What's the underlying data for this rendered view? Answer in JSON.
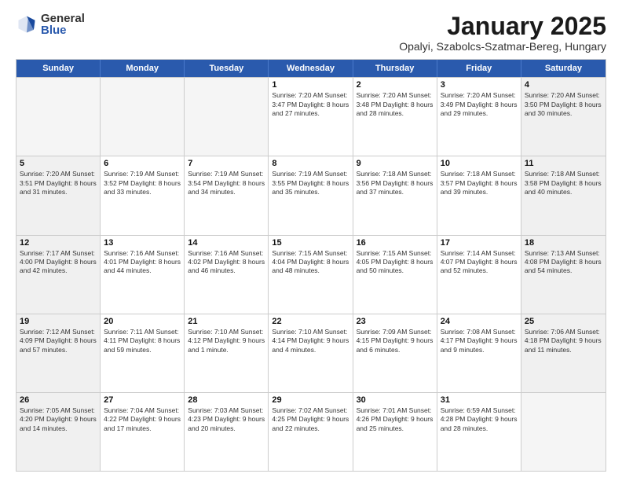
{
  "logo": {
    "general": "General",
    "blue": "Blue"
  },
  "title": "January 2025",
  "subtitle": "Opalyi, Szabolcs-Szatmar-Bereg, Hungary",
  "days_of_week": [
    "Sunday",
    "Monday",
    "Tuesday",
    "Wednesday",
    "Thursday",
    "Friday",
    "Saturday"
  ],
  "weeks": [
    [
      {
        "day": "",
        "info": ""
      },
      {
        "day": "",
        "info": ""
      },
      {
        "day": "",
        "info": ""
      },
      {
        "day": "1",
        "info": "Sunrise: 7:20 AM\nSunset: 3:47 PM\nDaylight: 8 hours and 27 minutes."
      },
      {
        "day": "2",
        "info": "Sunrise: 7:20 AM\nSunset: 3:48 PM\nDaylight: 8 hours and 28 minutes."
      },
      {
        "day": "3",
        "info": "Sunrise: 7:20 AM\nSunset: 3:49 PM\nDaylight: 8 hours and 29 minutes."
      },
      {
        "day": "4",
        "info": "Sunrise: 7:20 AM\nSunset: 3:50 PM\nDaylight: 8 hours and 30 minutes."
      }
    ],
    [
      {
        "day": "5",
        "info": "Sunrise: 7:20 AM\nSunset: 3:51 PM\nDaylight: 8 hours and 31 minutes."
      },
      {
        "day": "6",
        "info": "Sunrise: 7:19 AM\nSunset: 3:52 PM\nDaylight: 8 hours and 33 minutes."
      },
      {
        "day": "7",
        "info": "Sunrise: 7:19 AM\nSunset: 3:54 PM\nDaylight: 8 hours and 34 minutes."
      },
      {
        "day": "8",
        "info": "Sunrise: 7:19 AM\nSunset: 3:55 PM\nDaylight: 8 hours and 35 minutes."
      },
      {
        "day": "9",
        "info": "Sunrise: 7:18 AM\nSunset: 3:56 PM\nDaylight: 8 hours and 37 minutes."
      },
      {
        "day": "10",
        "info": "Sunrise: 7:18 AM\nSunset: 3:57 PM\nDaylight: 8 hours and 39 minutes."
      },
      {
        "day": "11",
        "info": "Sunrise: 7:18 AM\nSunset: 3:58 PM\nDaylight: 8 hours and 40 minutes."
      }
    ],
    [
      {
        "day": "12",
        "info": "Sunrise: 7:17 AM\nSunset: 4:00 PM\nDaylight: 8 hours and 42 minutes."
      },
      {
        "day": "13",
        "info": "Sunrise: 7:16 AM\nSunset: 4:01 PM\nDaylight: 8 hours and 44 minutes."
      },
      {
        "day": "14",
        "info": "Sunrise: 7:16 AM\nSunset: 4:02 PM\nDaylight: 8 hours and 46 minutes."
      },
      {
        "day": "15",
        "info": "Sunrise: 7:15 AM\nSunset: 4:04 PM\nDaylight: 8 hours and 48 minutes."
      },
      {
        "day": "16",
        "info": "Sunrise: 7:15 AM\nSunset: 4:05 PM\nDaylight: 8 hours and 50 minutes."
      },
      {
        "day": "17",
        "info": "Sunrise: 7:14 AM\nSunset: 4:07 PM\nDaylight: 8 hours and 52 minutes."
      },
      {
        "day": "18",
        "info": "Sunrise: 7:13 AM\nSunset: 4:08 PM\nDaylight: 8 hours and 54 minutes."
      }
    ],
    [
      {
        "day": "19",
        "info": "Sunrise: 7:12 AM\nSunset: 4:09 PM\nDaylight: 8 hours and 57 minutes."
      },
      {
        "day": "20",
        "info": "Sunrise: 7:11 AM\nSunset: 4:11 PM\nDaylight: 8 hours and 59 minutes."
      },
      {
        "day": "21",
        "info": "Sunrise: 7:10 AM\nSunset: 4:12 PM\nDaylight: 9 hours and 1 minute."
      },
      {
        "day": "22",
        "info": "Sunrise: 7:10 AM\nSunset: 4:14 PM\nDaylight: 9 hours and 4 minutes."
      },
      {
        "day": "23",
        "info": "Sunrise: 7:09 AM\nSunset: 4:15 PM\nDaylight: 9 hours and 6 minutes."
      },
      {
        "day": "24",
        "info": "Sunrise: 7:08 AM\nSunset: 4:17 PM\nDaylight: 9 hours and 9 minutes."
      },
      {
        "day": "25",
        "info": "Sunrise: 7:06 AM\nSunset: 4:18 PM\nDaylight: 9 hours and 11 minutes."
      }
    ],
    [
      {
        "day": "26",
        "info": "Sunrise: 7:05 AM\nSunset: 4:20 PM\nDaylight: 9 hours and 14 minutes."
      },
      {
        "day": "27",
        "info": "Sunrise: 7:04 AM\nSunset: 4:22 PM\nDaylight: 9 hours and 17 minutes."
      },
      {
        "day": "28",
        "info": "Sunrise: 7:03 AM\nSunset: 4:23 PM\nDaylight: 9 hours and 20 minutes."
      },
      {
        "day": "29",
        "info": "Sunrise: 7:02 AM\nSunset: 4:25 PM\nDaylight: 9 hours and 22 minutes."
      },
      {
        "day": "30",
        "info": "Sunrise: 7:01 AM\nSunset: 4:26 PM\nDaylight: 9 hours and 25 minutes."
      },
      {
        "day": "31",
        "info": "Sunrise: 6:59 AM\nSunset: 4:28 PM\nDaylight: 9 hours and 28 minutes."
      },
      {
        "day": "",
        "info": ""
      }
    ]
  ]
}
